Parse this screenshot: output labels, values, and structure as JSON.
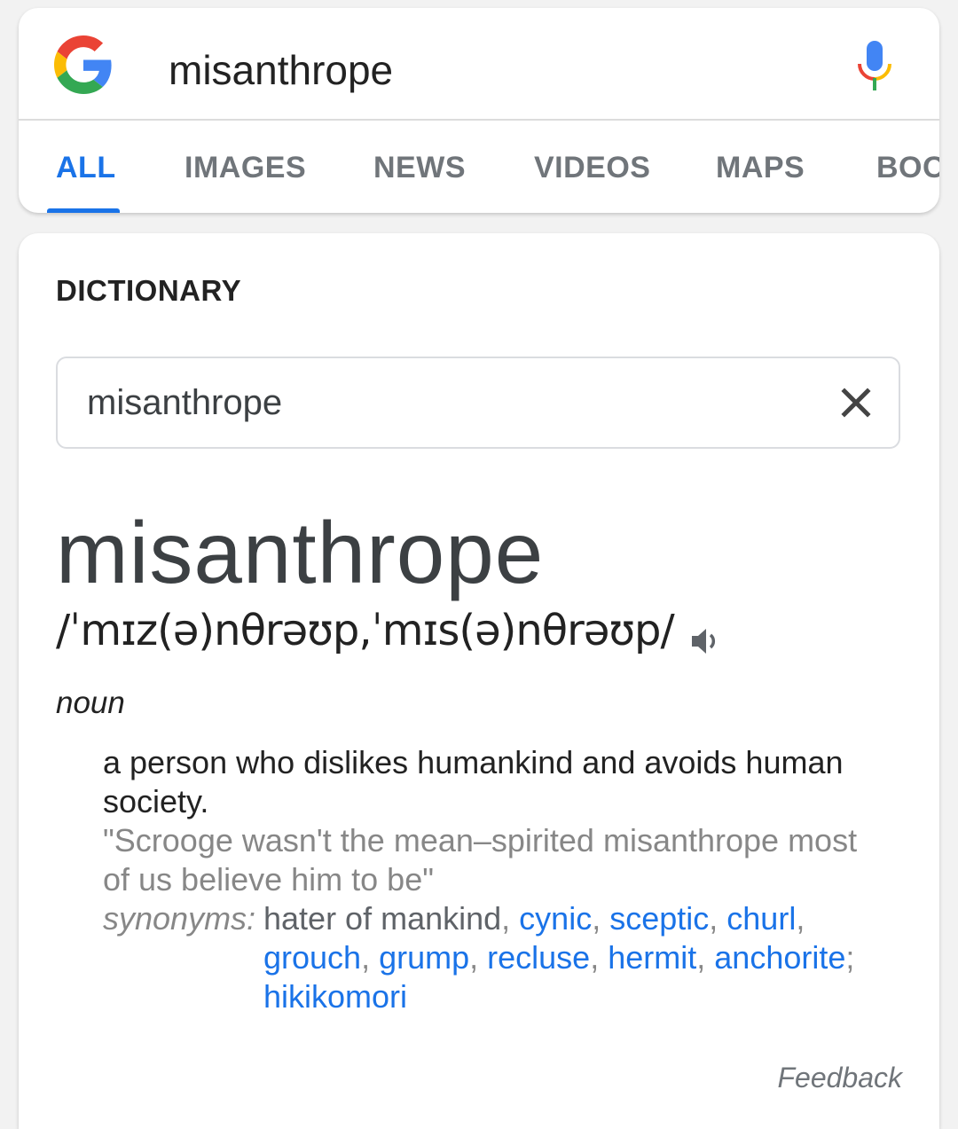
{
  "search": {
    "query": "misanthrope"
  },
  "tabs": [
    {
      "label": "ALL",
      "active": true
    },
    {
      "label": "IMAGES"
    },
    {
      "label": "NEWS"
    },
    {
      "label": "VIDEOS"
    },
    {
      "label": "MAPS"
    },
    {
      "label": "BOO"
    }
  ],
  "dictionary": {
    "section_label": "DICTIONARY",
    "input_value": "misanthrope",
    "headword": "misanthrope",
    "phonetic": "/ˈmɪz(ə)nθrəʊp,ˈmɪs(ə)nθrəʊp/",
    "part_of_speech": "noun",
    "definition": "a person who dislikes humankind and avoids human society.",
    "example": "\"Scrooge wasn't the mean–spirited misanthrope most of us believe him to be\"",
    "synonyms_label": "synonyms:",
    "synonyms": [
      {
        "word": "hater of mankind",
        "link": false
      },
      {
        "word": "cynic",
        "link": true
      },
      {
        "word": "sceptic",
        "link": true
      },
      {
        "word": "churl",
        "link": true
      },
      {
        "word": "grouch",
        "link": true
      },
      {
        "word": "grump",
        "link": true
      },
      {
        "word": "recluse",
        "link": true
      },
      {
        "word": "hermit",
        "link": true
      },
      {
        "word": "anchorite",
        "link": true
      },
      {
        "word": "hikikomori",
        "link": true
      }
    ],
    "feedback": "Feedback"
  },
  "icons": {
    "logo": "google-g-icon",
    "mic": "microphone-icon",
    "clear": "close-icon",
    "speaker": "speaker-icon"
  },
  "colors": {
    "accent": "#1a73e8",
    "g_blue": "#4285F4",
    "g_red": "#EA4335",
    "g_yellow": "#FBBC05",
    "g_green": "#34A853"
  }
}
